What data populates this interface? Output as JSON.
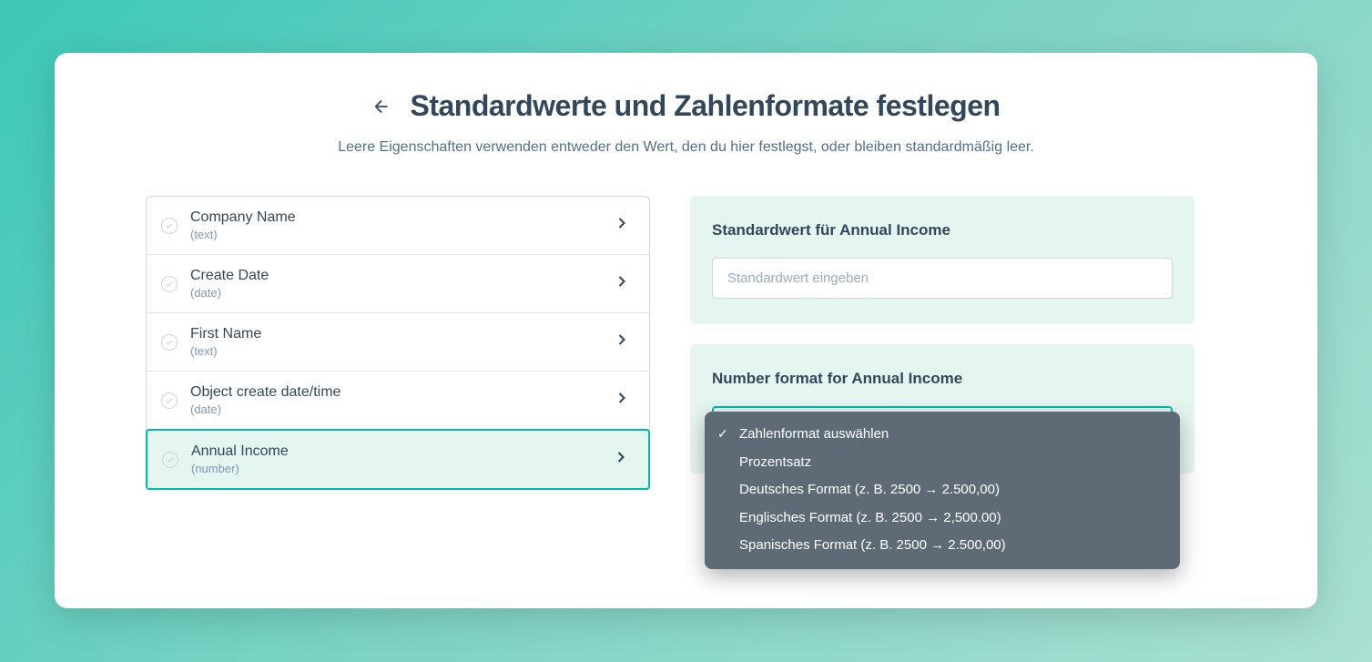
{
  "header": {
    "title": "Standardwerte und Zahlenformate festlegen",
    "subtitle": "Leere Eigenschaften verwenden entweder den Wert, den du hier festlegst, oder bleiben standardmäßig leer."
  },
  "properties": [
    {
      "name": "Company Name",
      "type": "(text)",
      "selected": false
    },
    {
      "name": "Create Date",
      "type": "(date)",
      "selected": false
    },
    {
      "name": "First Name",
      "type": "(text)",
      "selected": false
    },
    {
      "name": "Object create date/time",
      "type": "(date)",
      "selected": false
    },
    {
      "name": "Annual Income",
      "type": "(number)",
      "selected": true
    }
  ],
  "defaultValuePanel": {
    "title": "Standardwert für Annual Income",
    "placeholder": "Standardwert eingeben",
    "value": ""
  },
  "numberFormatPanel": {
    "title": "Number format for Annual Income",
    "options": [
      {
        "label": "Zahlenformat auswählen",
        "selected": true
      },
      {
        "label": "Prozentsatz",
        "selected": false
      },
      {
        "label": "Deutsches Format (z. B. 2500 → 2.500,00)",
        "selected": false
      },
      {
        "label": "Englisches Format (z. B. 2500 → 2,500.00)",
        "selected": false
      },
      {
        "label": "Spanisches Format (z. B. 2500 → 2.500,00)",
        "selected": false
      }
    ]
  },
  "colors": {
    "accent": "#00bda5",
    "panelBg": "#e5f5f0",
    "textPrimary": "#33475b",
    "textSecondary": "#7c98b6"
  }
}
